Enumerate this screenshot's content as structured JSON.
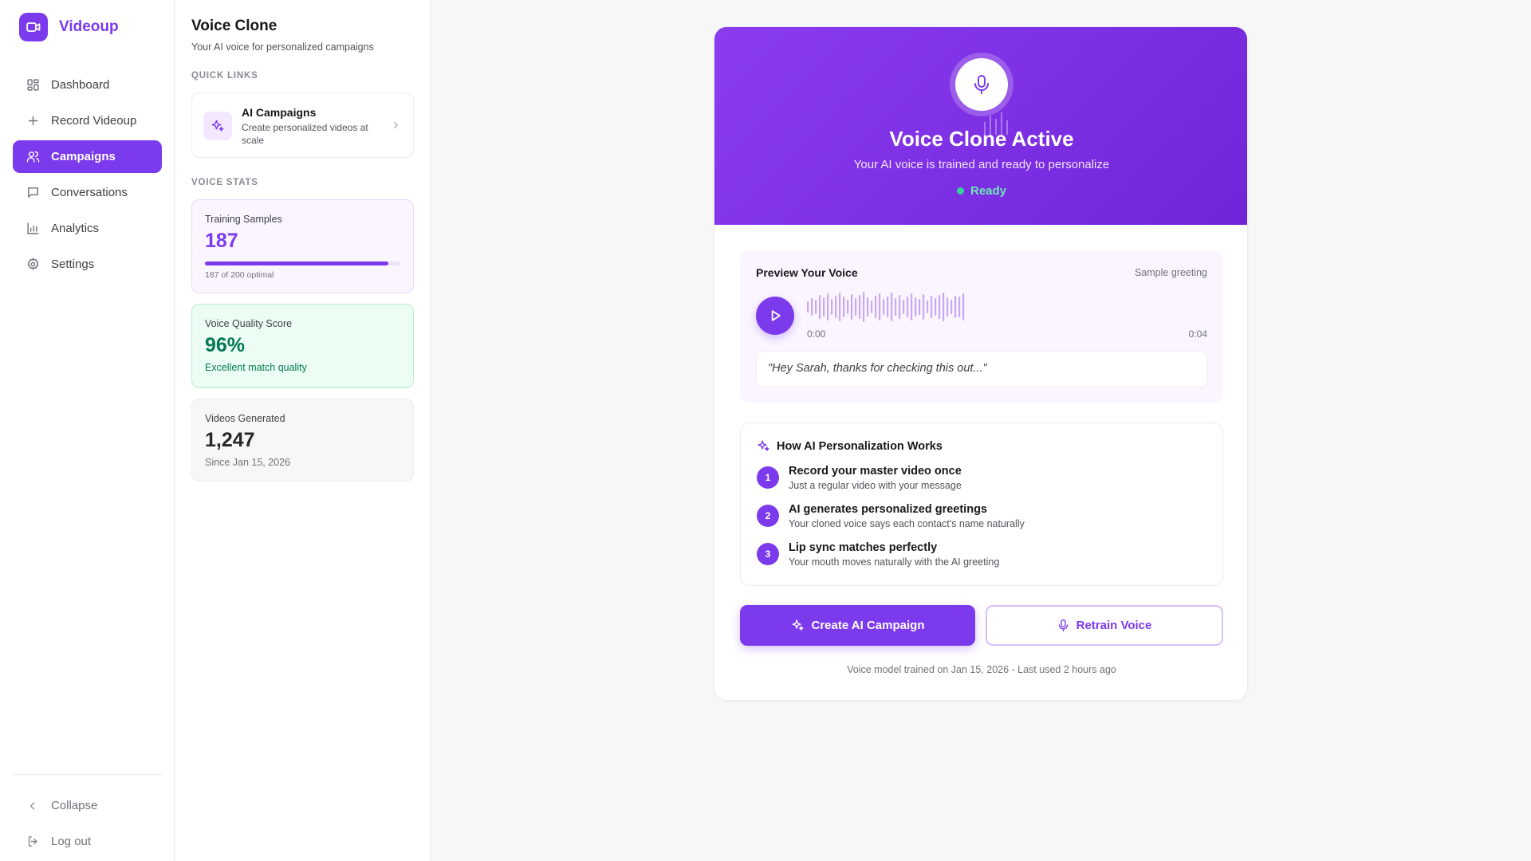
{
  "brand": {
    "name": "Videoup",
    "icon": "video-camera-icon"
  },
  "nav": {
    "items": [
      {
        "label": "Dashboard",
        "icon": "dashboard-icon",
        "active": false
      },
      {
        "label": "Record Videoup",
        "icon": "plus-icon",
        "active": false
      },
      {
        "label": "Campaigns",
        "icon": "users-icon",
        "active": true
      },
      {
        "label": "Conversations",
        "icon": "chat-icon",
        "active": false
      },
      {
        "label": "Analytics",
        "icon": "bar-chart-icon",
        "active": false
      },
      {
        "label": "Settings",
        "icon": "gear-icon",
        "active": false
      }
    ],
    "collapse_label": "Collapse",
    "logout_label": "Log out"
  },
  "panel": {
    "title": "Voice Clone",
    "subtitle": "Your AI voice for personalized campaigns",
    "quick_links_label": "QUICK LINKS",
    "quick_link": {
      "title": "AI Campaigns",
      "description": "Create personalized videos at scale",
      "icon": "sparkles-icon"
    },
    "voice_stats_label": "VOICE STATS",
    "stats": {
      "training": {
        "label": "Training Samples",
        "value": "187",
        "footnote": "187 of 200 optimal",
        "progress": 0.935
      },
      "quality": {
        "label": "Voice Quality Score",
        "value": "96%",
        "footnote": "Excellent match quality"
      },
      "videos": {
        "label": "Videos Generated",
        "value": "1,247",
        "footnote": "Since Jan 15, 2026"
      }
    }
  },
  "hero": {
    "icon": "microphone-icon",
    "title": "Voice Clone Active",
    "subtitle": "Your AI voice is trained and ready to personalize",
    "status": "Ready"
  },
  "preview": {
    "title": "Preview Your Voice",
    "tag": "Sample greeting",
    "time_start": "0:00",
    "time_end": "0:04",
    "quote": "\"Hey Sarah, thanks for checking this out...\""
  },
  "how": {
    "title": "How AI Personalization Works",
    "steps": [
      {
        "num": "1",
        "title": "Record your master video once",
        "desc": "Just a regular video with your message"
      },
      {
        "num": "2",
        "title": "AI generates personalized greetings",
        "desc": "Your cloned voice says each contact's name naturally"
      },
      {
        "num": "3",
        "title": "Lip sync matches perfectly",
        "desc": "Your mouth moves naturally with the AI greeting"
      }
    ]
  },
  "actions": {
    "primary": "Create AI Campaign",
    "secondary": "Retrain Voice"
  },
  "footnote": "Voice model trained on Jan 15, 2026 - Last used 2 hours ago",
  "colors": {
    "accent": "#7c3aed",
    "accent_light": "#f3e8ff",
    "success": "#34d399",
    "success_text": "#047857"
  }
}
